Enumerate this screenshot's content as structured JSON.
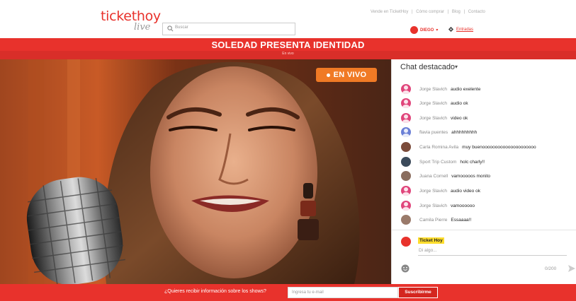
{
  "header": {
    "logo_main": "tickethoy",
    "logo_sub": "live",
    "search_placeholder": "Buscar",
    "top_links": [
      "Vende en TicketHoy",
      "|",
      "Cómo comprar",
      "|",
      "Blog",
      "|",
      "Contacto"
    ],
    "user_name": "DIEGO",
    "user_caret": "▾",
    "tickets_label": "Entradas"
  },
  "event": {
    "title": "SOLEDAD PRESENTA IDENTIDAD",
    "subtitle": "En vivo"
  },
  "video": {
    "live_label": "EN VIVO",
    "live_color": "#f07a25"
  },
  "chat": {
    "title": "Chat destacado",
    "caret": "▾",
    "messages": [
      {
        "name": "Jorge Slavich",
        "text": "audio exelente",
        "avatar": "default",
        "color": "#e0457b"
      },
      {
        "name": "Jorge Slavich",
        "text": "audio ok",
        "avatar": "default",
        "color": "#e0457b"
      },
      {
        "name": "Jorge Slavich",
        "text": "video ok",
        "avatar": "default",
        "color": "#e0457b"
      },
      {
        "name": "flavia puentes",
        "text": "ahhhhhhhhh",
        "avatar": "default",
        "color": "#6a7fd6"
      },
      {
        "name": "Carla Romina Avila",
        "text": "muy buenooooooooooooooooooooo",
        "avatar": "photo",
        "color": "#7b4b3a"
      },
      {
        "name": "Sport Trip Custom",
        "text": "holc charly!!",
        "avatar": "photo",
        "color": "#3b4a5a"
      },
      {
        "name": "Juana Cornell",
        "text": "vamooooos monito",
        "avatar": "photo",
        "color": "#8a6d5e"
      },
      {
        "name": "Jorge Slavich",
        "text": "audio video ok",
        "avatar": "default",
        "color": "#e0457b"
      },
      {
        "name": "Jorge Slavich",
        "text": "vamoooooo",
        "avatar": "default",
        "color": "#e0457b"
      },
      {
        "name": "Camila Pierre",
        "text": "Essaaaa!!",
        "avatar": "photo",
        "color": "#9a7a6a"
      }
    ],
    "composer_name": "Ticket Hoy",
    "composer_placeholder": "Di algo...",
    "counter": "0/200"
  },
  "footer": {
    "question": "¿Quieres recibir información sobre los shows?",
    "email_placeholder": "Ingresa tu e-mail",
    "subscribe_label": "Suscribirme"
  },
  "colors": {
    "brand": "#e8322c",
    "live": "#f07a25",
    "highlight": "#ffde2e"
  }
}
